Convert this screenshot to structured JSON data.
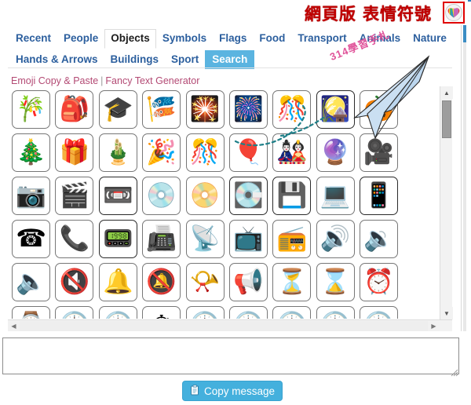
{
  "topbar": {
    "title_left": "網頁版",
    "title_right": "表情符號",
    "icon_name": "rainbow-heart-icon",
    "accent_red": "#c00000",
    "box_border": "#e00000"
  },
  "nav": {
    "row1": [
      {
        "label": "Recent",
        "state": "normal"
      },
      {
        "label": "People",
        "state": "normal"
      },
      {
        "label": "Objects",
        "state": "active"
      },
      {
        "label": "Symbols",
        "state": "normal"
      },
      {
        "label": "Flags",
        "state": "normal"
      },
      {
        "label": "Food",
        "state": "normal"
      },
      {
        "label": "Transport",
        "state": "normal"
      },
      {
        "label": "Animals",
        "state": "normal"
      },
      {
        "label": "Nature",
        "state": "normal"
      }
    ],
    "row2": [
      {
        "label": "Hands & Arrows",
        "state": "normal"
      },
      {
        "label": "Buildings",
        "state": "normal"
      },
      {
        "label": "Sport",
        "state": "normal"
      },
      {
        "label": "Search",
        "state": "highlight"
      }
    ],
    "link_color": "#b34a74",
    "active_color": "#1d1d1d",
    "tab_color": "#2c5f9e",
    "search_bg": "#5bb4e0"
  },
  "links": {
    "first": "Emoji Copy & Paste",
    "separator": "|",
    "second": "Fancy Text Generator"
  },
  "grid": {
    "columns": 9,
    "emojis": [
      {
        "name": "tanabata-tree",
        "glyph": "🎋"
      },
      {
        "name": "school-backpack",
        "glyph": "🎒"
      },
      {
        "name": "graduation-cap",
        "glyph": "🎓"
      },
      {
        "name": "carp-streamer",
        "glyph": "🎏"
      },
      {
        "name": "sparkler",
        "glyph": "🎇"
      },
      {
        "name": "firework-sparkler",
        "glyph": "🎆"
      },
      {
        "name": "confetti-ball",
        "glyph": "🎊"
      },
      {
        "name": "moon-viewing-ceremony",
        "glyph": "🎑"
      },
      {
        "name": "jack-o-lantern",
        "glyph": "🎃"
      },
      {
        "name": "christmas-tree",
        "glyph": "🎄"
      },
      {
        "name": "wrapped-gift",
        "glyph": "🎁"
      },
      {
        "name": "pine-decoration",
        "glyph": "🎍"
      },
      {
        "name": "party-popper",
        "glyph": "🎉"
      },
      {
        "name": "confetti-streamers",
        "glyph": "🎊"
      },
      {
        "name": "balloon",
        "glyph": "🎈"
      },
      {
        "name": "crossed-flags",
        "glyph": "🎎"
      },
      {
        "name": "crystal-ball",
        "glyph": "🔮"
      },
      {
        "name": "movie-camera",
        "glyph": "🎥"
      },
      {
        "name": "camera",
        "glyph": "📷"
      },
      {
        "name": "clapper-board",
        "glyph": "🎬"
      },
      {
        "name": "videocassette",
        "glyph": "📼"
      },
      {
        "name": "optical-disk",
        "glyph": "💿"
      },
      {
        "name": "dvd",
        "glyph": "📀"
      },
      {
        "name": "minidisc",
        "glyph": "💽"
      },
      {
        "name": "floppy-disk",
        "glyph": "💾"
      },
      {
        "name": "laptop",
        "glyph": "💻"
      },
      {
        "name": "mobile-phone",
        "glyph": "📱"
      },
      {
        "name": "telephone",
        "glyph": "☎"
      },
      {
        "name": "telephone-receiver",
        "glyph": "📞"
      },
      {
        "name": "pager",
        "glyph": "📟"
      },
      {
        "name": "fax-machine",
        "glyph": "📠"
      },
      {
        "name": "satellite-antenna",
        "glyph": "📡"
      },
      {
        "name": "television",
        "glyph": "📺"
      },
      {
        "name": "radio",
        "glyph": "📻"
      },
      {
        "name": "speaker-high-volume",
        "glyph": "🔊"
      },
      {
        "name": "speaker-medium-volume",
        "glyph": "🔉"
      },
      {
        "name": "speaker-low-volume",
        "glyph": "🔈"
      },
      {
        "name": "muted-speaker",
        "glyph": "🔇"
      },
      {
        "name": "bell",
        "glyph": "🔔"
      },
      {
        "name": "bell-with-slash",
        "glyph": "🔕"
      },
      {
        "name": "postal-horn",
        "glyph": "📯"
      },
      {
        "name": "loudspeaker",
        "glyph": "📢"
      },
      {
        "name": "hourglass-flowing",
        "glyph": "⏳"
      },
      {
        "name": "hourglass-done",
        "glyph": "⌛"
      },
      {
        "name": "alarm-clock",
        "glyph": "⏰"
      },
      {
        "name": "watch",
        "glyph": "⌚"
      },
      {
        "name": "clock-twelve",
        "glyph": "🕛"
      },
      {
        "name": "clock-one",
        "glyph": "🕐"
      },
      {
        "name": "stopwatch",
        "glyph": "⏱"
      },
      {
        "name": "clock-two",
        "glyph": "🕑"
      },
      {
        "name": "clock-three",
        "glyph": "🕒"
      },
      {
        "name": "clock-four",
        "glyph": "🕓"
      },
      {
        "name": "clock-five",
        "glyph": "🕔"
      },
      {
        "name": "clock-six",
        "glyph": "🕕"
      }
    ]
  },
  "scroll": {
    "vertical_arrow_up": "▲",
    "vertical_arrow_down": "▼",
    "horizontal_arrow_left": "◀",
    "horizontal_arrow_right": "▶"
  },
  "message": {
    "value": "",
    "placeholder": ""
  },
  "copy_button": {
    "label": "Copy message",
    "icon_name": "clipboard-icon",
    "bg": "#44b0dd"
  },
  "annotation": {
    "watermark_text": "314學習手札",
    "watermark_color": "#e0539a",
    "airplane_name": "paper-airplane-watermark",
    "dotted_curve_color": "#1f7f88"
  }
}
